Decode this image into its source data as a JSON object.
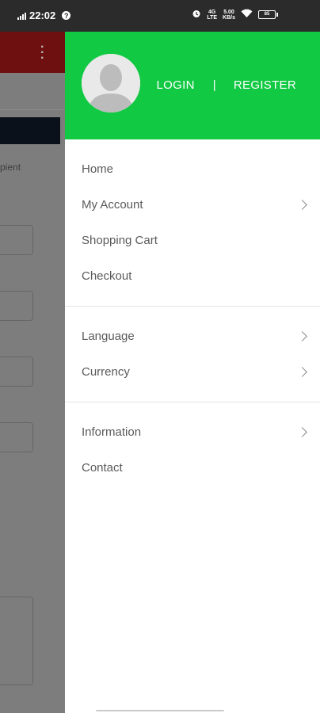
{
  "status_bar": {
    "time": "22:02",
    "badge": "?",
    "net_top": "4G",
    "net_bottom": "LTE",
    "speed_top": "5.00",
    "speed_bottom": "KB/s",
    "battery": "85"
  },
  "drawer": {
    "header_color": "#12c943",
    "login": "LOGIN",
    "separator": "|",
    "register": "REGISTER",
    "groups": [
      [
        {
          "label": "Home",
          "has_submenu": false
        },
        {
          "label": "My Account",
          "has_submenu": true
        },
        {
          "label": "Shopping Cart",
          "has_submenu": false
        },
        {
          "label": "Checkout",
          "has_submenu": false
        }
      ],
      [
        {
          "label": "Language",
          "has_submenu": true
        },
        {
          "label": "Currency",
          "has_submenu": true
        }
      ],
      [
        {
          "label": "Information",
          "has_submenu": true
        },
        {
          "label": "Contact",
          "has_submenu": false
        }
      ]
    ]
  },
  "background_app": {
    "header_color": "#6e1010",
    "partial_text": "pient"
  }
}
